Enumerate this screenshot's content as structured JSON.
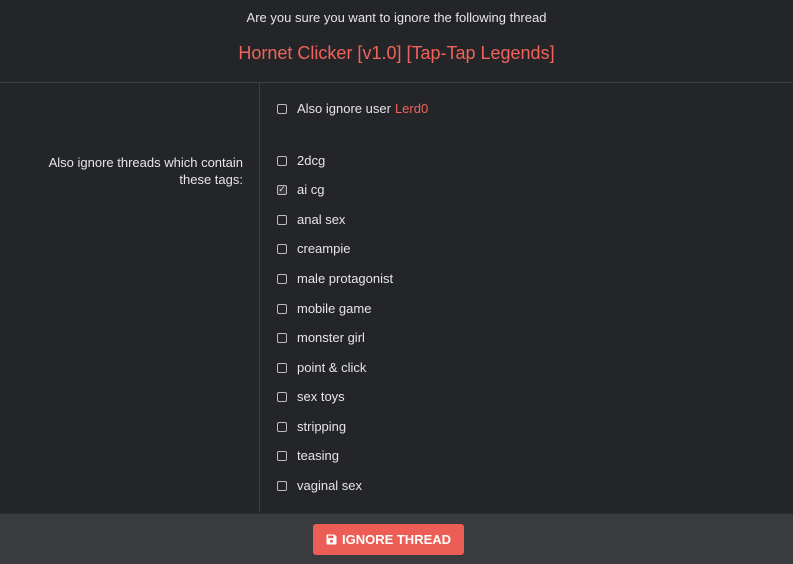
{
  "header": {
    "question": "Are you sure you want to ignore the following thread",
    "thread_title": "Hornet Clicker [v1.0] [Tap-Tap Legends]"
  },
  "ignore_user": {
    "label": "Also ignore user",
    "username": "Lerd0",
    "checked": false
  },
  "tags_label": "Also ignore threads which contain these tags:",
  "tags": [
    {
      "label": "2dcg",
      "checked": false
    },
    {
      "label": "ai cg",
      "checked": true
    },
    {
      "label": "anal sex",
      "checked": false
    },
    {
      "label": "creampie",
      "checked": false
    },
    {
      "label": "male protagonist",
      "checked": false
    },
    {
      "label": "mobile game",
      "checked": false
    },
    {
      "label": "monster girl",
      "checked": false
    },
    {
      "label": "point & click",
      "checked": false
    },
    {
      "label": "sex toys",
      "checked": false
    },
    {
      "label": "stripping",
      "checked": false
    },
    {
      "label": "teasing",
      "checked": false
    },
    {
      "label": "vaginal sex",
      "checked": false
    }
  ],
  "footer": {
    "button_label": "IGNORE THREAD",
    "button_icon": "save-icon"
  },
  "colors": {
    "accent": "#f1635a",
    "button": "#ec5e55",
    "background": "#242529",
    "footer": "#3a3b3f"
  }
}
